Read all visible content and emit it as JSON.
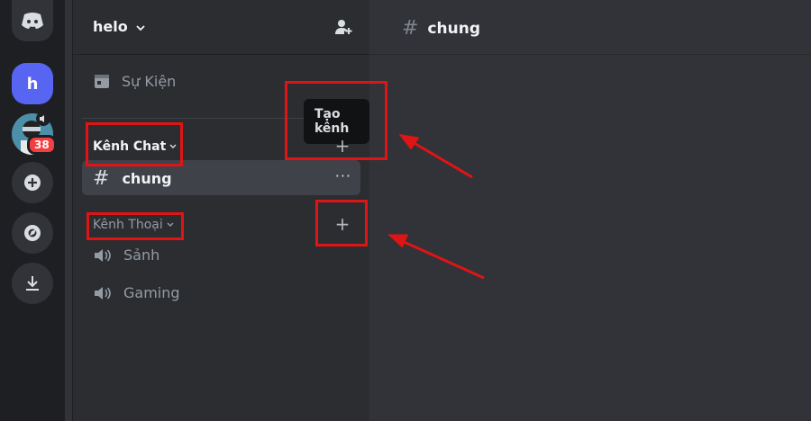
{
  "rail": {
    "home_icon": "discord-logo-icon",
    "server_letter": "h",
    "avatar_badge": "38",
    "add_server_icon": "plus-circle-icon",
    "discover_icon": "compass-icon",
    "download_icon": "download-icon"
  },
  "sidebar": {
    "server_name": "helo",
    "events_label": "Sự Kiện",
    "tooltip": "Tạo kênh",
    "categories": [
      {
        "label": "Kênh Chat",
        "channels": [
          {
            "name": "chung",
            "type": "text",
            "active": true
          }
        ]
      },
      {
        "label": "Kênh Thoại",
        "channels": [
          {
            "name": "Sảnh",
            "type": "voice"
          },
          {
            "name": "Gaming",
            "type": "voice"
          }
        ]
      }
    ]
  },
  "main": {
    "channel_name": "chung"
  },
  "colors": {
    "annotation": "#e01414",
    "accent": "#5865f2",
    "badge": "#f23f43"
  }
}
